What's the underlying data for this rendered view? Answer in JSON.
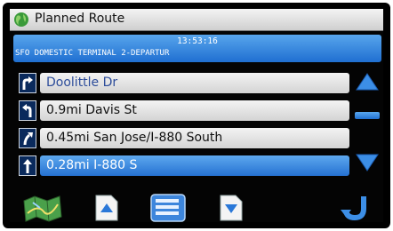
{
  "app": {
    "title": "Planned Route"
  },
  "info": {
    "time": "13:53:16",
    "destination": "SFO DOMESTIC TERMINAL 2-DEPARTUR"
  },
  "route": [
    {
      "text": "Doolittle Dr",
      "turn_icon": "turn-right-icon",
      "selected": false
    },
    {
      "text": "0.9mi Davis St",
      "turn_icon": "turn-left-icon",
      "selected": false
    },
    {
      "text": "0.45mi San Jose/I-880 South",
      "turn_icon": "bear-right-icon",
      "selected": false
    },
    {
      "text": "0.28mi I-880 S",
      "turn_icon": "straight-icon",
      "selected": true
    }
  ],
  "colors": {
    "accent": "#2a78d8",
    "accent_light": "#5aa8ee",
    "background": "#040404",
    "row": "#e2e2e2"
  }
}
